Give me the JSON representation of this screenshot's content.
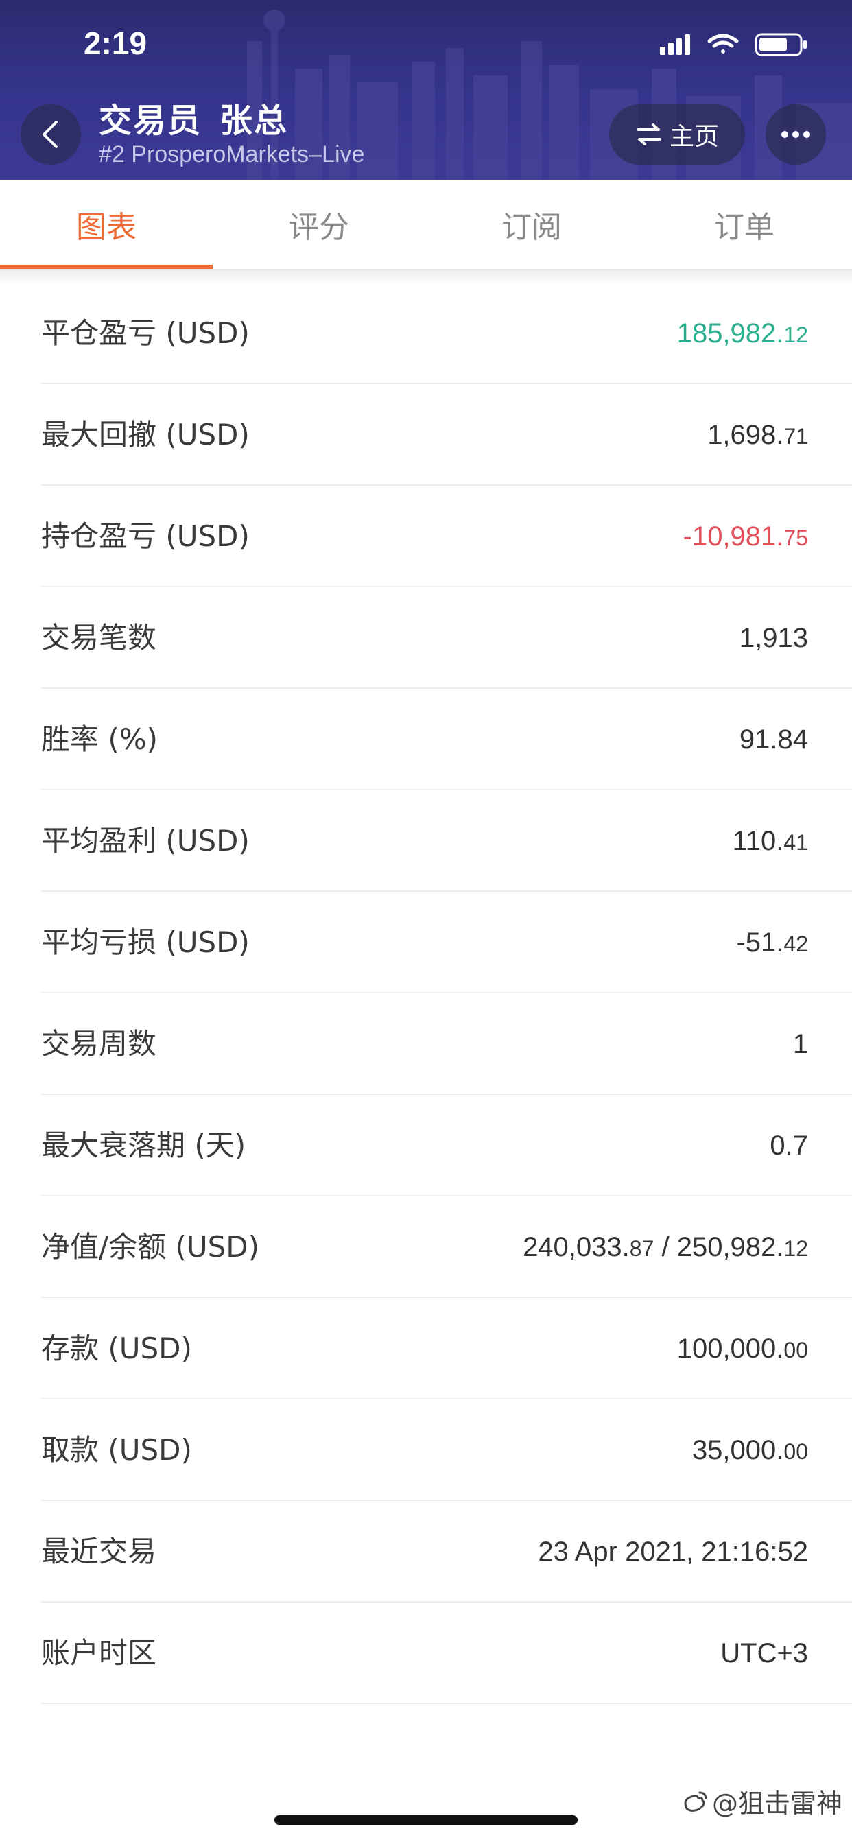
{
  "status_bar": {
    "time": "2:19"
  },
  "header": {
    "trader_prefix": "交易员",
    "trader_name": "张总",
    "account": "#2 ProsperoMarkets–Live",
    "home_label": "主页",
    "icons": {
      "back": "chevron-left-icon",
      "home": "swap-arrows-icon",
      "more": "more-dots-icon"
    }
  },
  "tabs": [
    {
      "label": "图表",
      "active": true
    },
    {
      "label": "评分",
      "active": false
    },
    {
      "label": "订阅",
      "active": false
    },
    {
      "label": "订单",
      "active": false
    }
  ],
  "colors": {
    "accent": "#f06a35",
    "positive": "#2ab08f",
    "negative": "#e0505a",
    "header_bg": "#34338a"
  },
  "stats": [
    {
      "label": "平仓盈亏 (USD)",
      "main": "185,982.",
      "small": "12",
      "tone": "green"
    },
    {
      "label": "最大回撤 (USD)",
      "main": "1,698.",
      "small": "71",
      "tone": ""
    },
    {
      "label": "持仓盈亏 (USD)",
      "main": "-10,981.",
      "small": "75",
      "tone": "red"
    },
    {
      "label": "交易笔数",
      "main": "1,913",
      "small": "",
      "tone": ""
    },
    {
      "label": "胜率 (%)",
      "main": "91.84",
      "small": "",
      "tone": ""
    },
    {
      "label": "平均盈利 (USD)",
      "main": "110.",
      "small": "41",
      "tone": ""
    },
    {
      "label": "平均亏损 (USD)",
      "main": "-51.",
      "small": "42",
      "tone": ""
    },
    {
      "label": "交易周数",
      "main": "1",
      "small": "",
      "tone": ""
    },
    {
      "label": "最大衰落期 (天)",
      "main": "0.7",
      "small": "",
      "tone": ""
    },
    {
      "label": "净值/余额 (USD)",
      "main": "240,033.",
      "small": "87",
      "main2": " / 250,982.",
      "small2": "12",
      "tone": ""
    },
    {
      "label": "存款 (USD)",
      "main": "100,000.",
      "small": "00",
      "tone": ""
    },
    {
      "label": "取款 (USD)",
      "main": "35,000.",
      "small": "00",
      "tone": ""
    },
    {
      "label": "最近交易",
      "main": "23 Apr 2021, 21:16:52",
      "small": "",
      "tone": ""
    },
    {
      "label": "账户时区",
      "main": "UTC+3",
      "small": "",
      "tone": ""
    }
  ],
  "watermark": "@狙击雷神"
}
